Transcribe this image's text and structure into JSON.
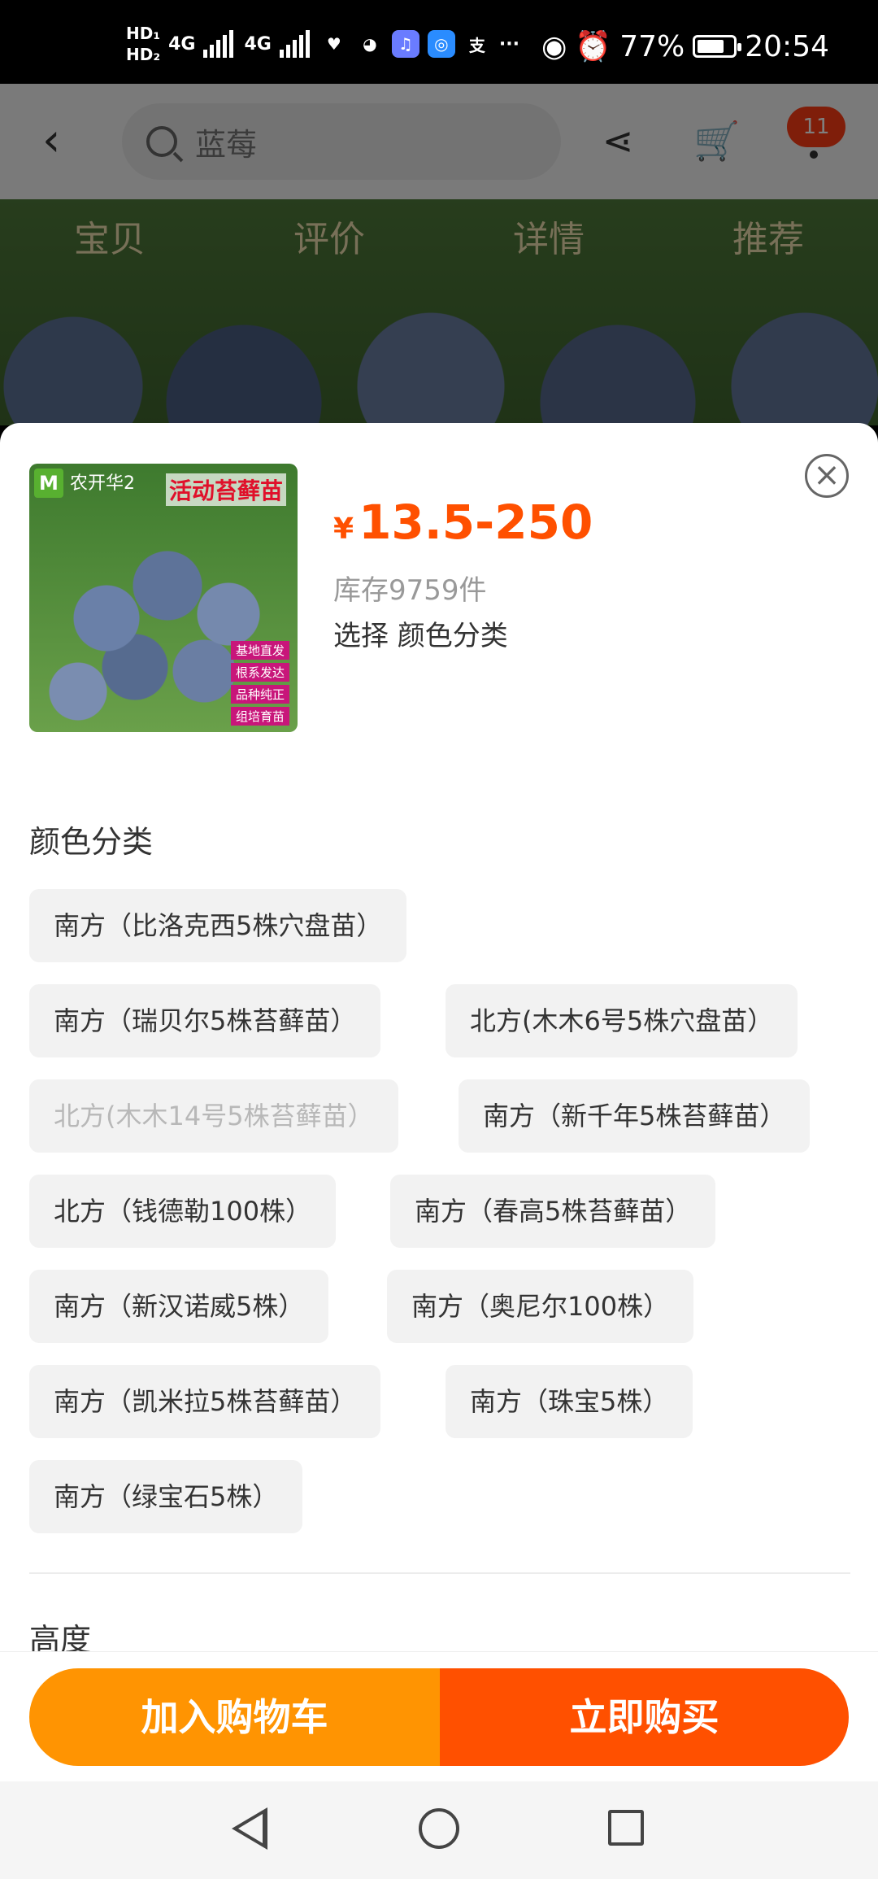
{
  "status_bar": {
    "hd1": "HD₁",
    "hd2": "HD₂",
    "net1": "4G",
    "net2": "4G",
    "apps": [
      "health-icon",
      "wechat-icon",
      "music-icon",
      "browser-icon",
      "alipay-icon"
    ],
    "more": "···",
    "battery": "77%",
    "battery_level": 0.77,
    "time": "20:54"
  },
  "background_page": {
    "search_text": "蓝莓",
    "cart_badge": "11",
    "tabs": [
      "宝贝",
      "评价",
      "详情",
      "推荐"
    ]
  },
  "product": {
    "thumb": {
      "logo": "M",
      "brand": "农开华2",
      "promo": "活动苔藓苗",
      "checks": [
        "基地直发",
        "根系发达",
        "品种纯正",
        "组培育苗"
      ]
    },
    "currency": "¥",
    "price": "13.5-250",
    "stock": "库存9759件",
    "selection": "选择 颜色分类"
  },
  "color_section": {
    "title": "颜色分类",
    "options": [
      {
        "label": "南方（比洛克西5株穴盘苗）",
        "disabled": false
      },
      {
        "label": "南方（瑞贝尔5株苔藓苗）",
        "disabled": false
      },
      {
        "label": "北方(木木6号5株穴盘苗）",
        "disabled": false
      },
      {
        "label": "北方(木木14号5株苔藓苗）",
        "disabled": true
      },
      {
        "label": "南方（新千年5株苔藓苗）",
        "disabled": false
      },
      {
        "label": "北方（钱德勒100株）",
        "disabled": false
      },
      {
        "label": "南方（春高5株苔藓苗）",
        "disabled": false
      },
      {
        "label": "南方（新汉诺威5株）",
        "disabled": false
      },
      {
        "label": "南方（奥尼尔100株）",
        "disabled": false
      },
      {
        "label": "南方（凯米拉5株苔藓苗）",
        "disabled": false
      },
      {
        "label": "南方（珠宝5株）",
        "disabled": false
      },
      {
        "label": "南方（绿宝石5株）",
        "disabled": false
      }
    ]
  },
  "height_section": {
    "title": "高度"
  },
  "actions": {
    "add_to_cart": "加入购物车",
    "buy_now": "立即购买"
  }
}
